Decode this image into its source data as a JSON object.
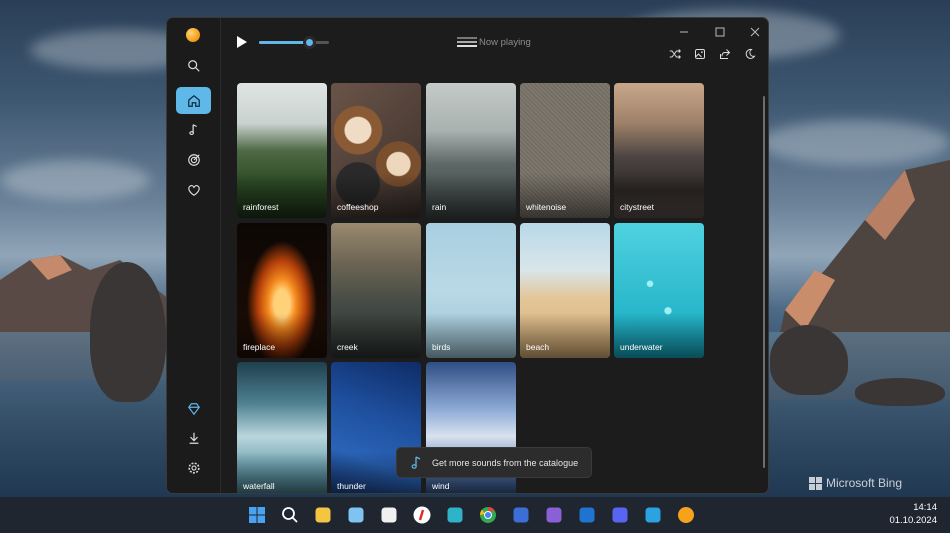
{
  "desktop": {
    "brand_label": "Microsoft Bing"
  },
  "app": {
    "now_playing": "Now playing",
    "volume_level": 0.72,
    "sidebar": {
      "items": [
        {
          "icon": "search-icon",
          "active": false
        },
        {
          "icon": "home-icon",
          "active": true
        },
        {
          "icon": "music-note-icon",
          "active": false
        },
        {
          "icon": "target-icon",
          "active": false
        },
        {
          "icon": "heart-leaf-icon",
          "active": false
        },
        {
          "icon": "diamond-icon",
          "active": false
        },
        {
          "icon": "download-icon",
          "active": false
        },
        {
          "icon": "settings-icon",
          "active": false
        }
      ]
    },
    "toolbar": {
      "buttons": [
        "shuffle-icon",
        "image-icon",
        "share-icon",
        "moon-icon"
      ]
    },
    "sounds": [
      {
        "label": "rainforest"
      },
      {
        "label": "coffeeshop"
      },
      {
        "label": "rain"
      },
      {
        "label": "whitenoise"
      },
      {
        "label": "citystreet"
      },
      {
        "label": "fireplace"
      },
      {
        "label": "creek"
      },
      {
        "label": "birds"
      },
      {
        "label": "beach"
      },
      {
        "label": "underwater"
      },
      {
        "label": "waterfall"
      },
      {
        "label": "thunder"
      },
      {
        "label": "wind"
      }
    ],
    "catalogue_prompt": "Get more sounds from the catalogue"
  },
  "taskbar": {
    "apps": [
      "start-icon",
      "search-icon",
      "file-explorer-icon",
      "notepad-icon",
      "store-icon",
      "yandex-browser-icon",
      "edge-icon",
      "chrome-icon",
      "floppy-app-icon",
      "visual-studio-icon",
      "outlook-icon",
      "discord-icon",
      "telegram-icon",
      "sound-app-icon"
    ],
    "time": "14:14",
    "date": "01.10.2024"
  },
  "colors": {
    "accent": "#60b8e8",
    "window_bg": "#1c1c1c"
  }
}
